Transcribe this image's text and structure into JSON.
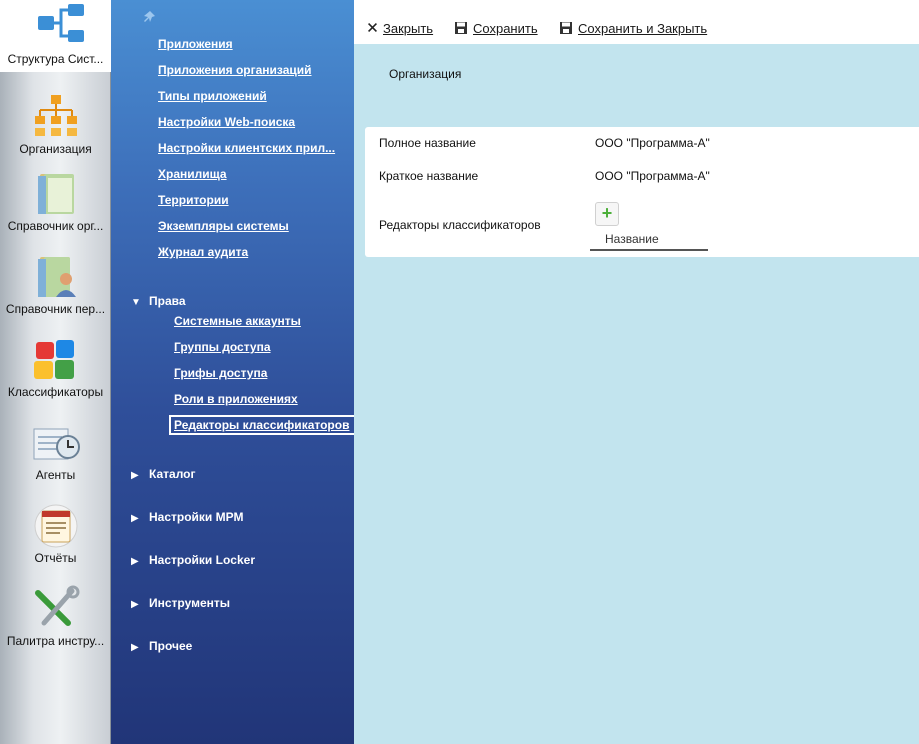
{
  "rail": {
    "items": [
      {
        "label": "Структура Сист...",
        "icon": "structure-icon",
        "active": true
      },
      {
        "label": "Организация",
        "icon": "organization-icon"
      },
      {
        "label": "Справочник орг...",
        "icon": "org-directory-icon"
      },
      {
        "label": "Справочник пер...",
        "icon": "personnel-directory-icon"
      },
      {
        "label": "Классификаторы",
        "icon": "classifiers-icon"
      },
      {
        "label": "Агенты",
        "icon": "agents-icon"
      },
      {
        "label": "Отчёты",
        "icon": "reports-icon"
      },
      {
        "label": "Палитра инстру...",
        "icon": "tools-palette-icon"
      }
    ]
  },
  "nav": {
    "links": [
      "Приложения",
      "Приложения организаций",
      "Типы приложений",
      "Настройки Web-поиска",
      "Настройки клиентских прил...",
      "Хранилища",
      "Территории",
      "Экземпляры системы",
      "Журнал аудита"
    ],
    "rights_group": {
      "label": "Права",
      "items": [
        "Системные аккаунты",
        "Группы доступа",
        "Грифы доступа",
        "Роли в приложениях",
        "Редакторы классификаторов"
      ]
    },
    "groups": [
      "Каталог",
      "Настройки МРМ",
      "Настройки Locker",
      "Инструменты",
      "Прочее"
    ]
  },
  "toolbar": {
    "close_label": "Закрыть",
    "save_label": "Сохранить",
    "save_close_label": "Сохранить и Закрыть"
  },
  "tab": {
    "label": "Организация"
  },
  "form": {
    "full_name_label": "Полное название",
    "full_name_value": "ООО \"Программа-А\"",
    "short_name_label": "Краткое название",
    "short_name_value": "ООО \"Программа-А\"",
    "editors_label": "Редакторы классификаторов",
    "column_header": "Название"
  }
}
